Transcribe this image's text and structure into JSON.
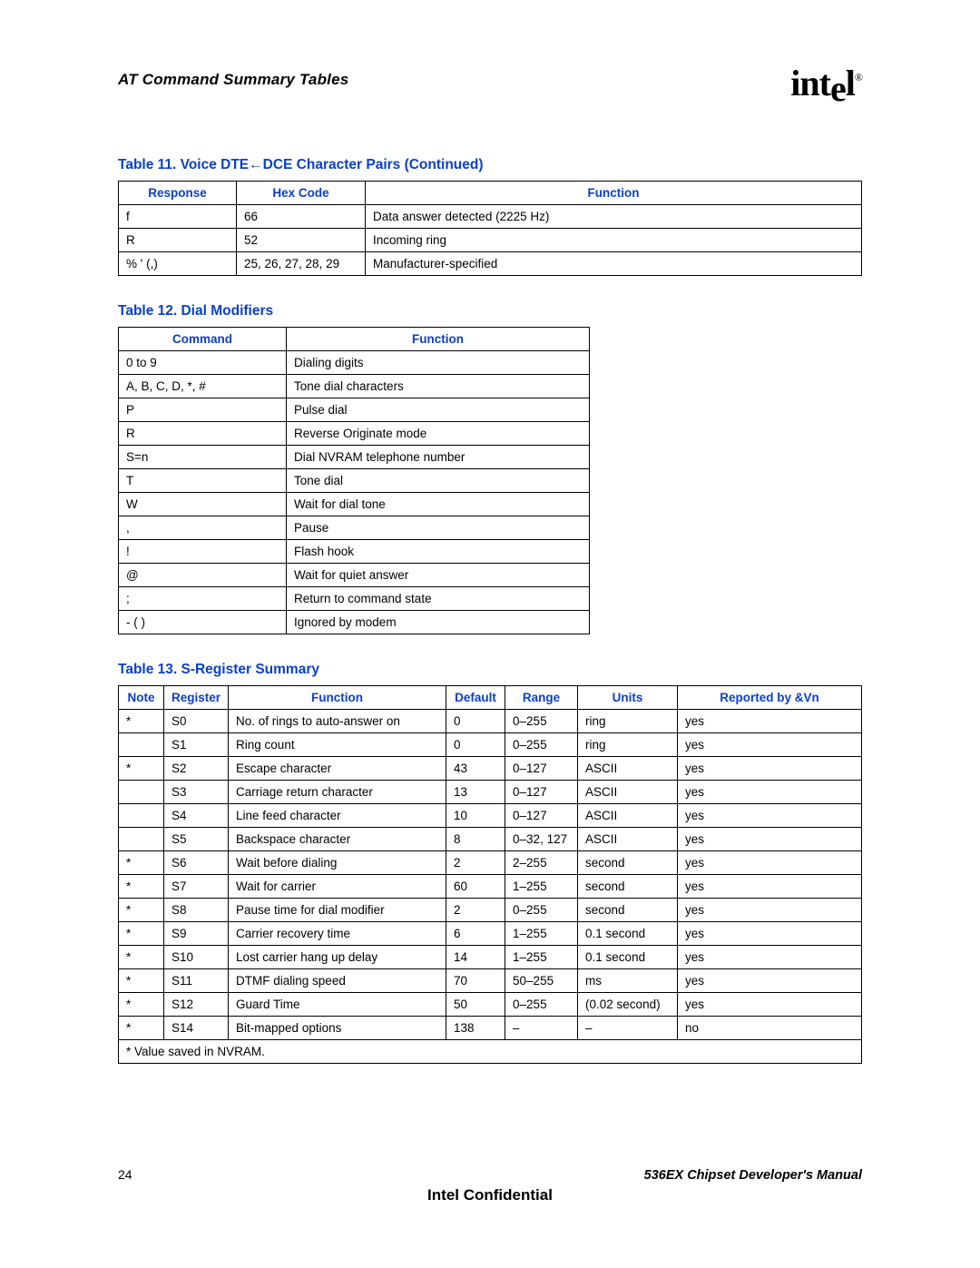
{
  "header": {
    "section_title": "AT Command Summary Tables",
    "logo_text": "intel",
    "logo_reg": "®"
  },
  "table11": {
    "caption": "Table 11.  Voice DTE←DCE Character Pairs (Continued)",
    "headers": {
      "response": "Response",
      "hex": "Hex Code",
      "function": "Function"
    },
    "rows": [
      {
        "response": "f",
        "hex": "66",
        "function": "Data answer detected (2225 Hz)"
      },
      {
        "response": "R",
        "hex": "52",
        "function": "Incoming ring"
      },
      {
        "response": "% ' (,)",
        "hex": "25, 26, 27, 28, 29",
        "function": "Manufacturer-specified"
      }
    ]
  },
  "table12": {
    "caption": "Table 12.  Dial Modifiers",
    "headers": {
      "command": "Command",
      "function": "Function"
    },
    "rows": [
      {
        "command": "0 to 9",
        "function": "Dialing digits"
      },
      {
        "command": "A, B, C, D, *, #",
        "function": "Tone dial characters"
      },
      {
        "command": "P",
        "function": "Pulse dial"
      },
      {
        "command": "R",
        "function": "Reverse Originate mode"
      },
      {
        "command": "S=n",
        "function": "Dial NVRAM telephone number"
      },
      {
        "command": "T",
        "function": "Tone dial"
      },
      {
        "command": "W",
        "function": "Wait for dial tone"
      },
      {
        "command": ",",
        "function": "Pause"
      },
      {
        "command": "!",
        "function": "Flash hook"
      },
      {
        "command": "@",
        "function": "Wait for quiet answer"
      },
      {
        "command": ";",
        "function": "Return to command state"
      },
      {
        "command": "- ( )",
        "function": "Ignored by modem"
      }
    ]
  },
  "table13": {
    "caption": "Table 13.  S-Register Summary",
    "headers": {
      "note": "Note",
      "register": "Register",
      "function": "Function",
      "default": "Default",
      "range": "Range",
      "units": "Units",
      "reported": "Reported by &Vn"
    },
    "rows": [
      {
        "note": "*",
        "register": "S0",
        "function": "No. of rings to auto-answer on",
        "default": "0",
        "range": "0–255",
        "units": "ring",
        "reported": "yes"
      },
      {
        "note": "",
        "register": "S1",
        "function": "Ring count",
        "default": "0",
        "range": "0–255",
        "units": "ring",
        "reported": "yes"
      },
      {
        "note": "*",
        "register": "S2",
        "function": "Escape character",
        "default": "43",
        "range": "0–127",
        "units": "ASCII",
        "reported": "yes"
      },
      {
        "note": "",
        "register": "S3",
        "function": "Carriage return character",
        "default": "13",
        "range": "0–127",
        "units": "ASCII",
        "reported": "yes"
      },
      {
        "note": "",
        "register": "S4",
        "function": "Line feed character",
        "default": "10",
        "range": "0–127",
        "units": "ASCII",
        "reported": "yes"
      },
      {
        "note": "",
        "register": "S5",
        "function": "Backspace character",
        "default": "8",
        "range": "0–32, 127",
        "units": "ASCII",
        "reported": "yes"
      },
      {
        "note": "*",
        "register": "S6",
        "function": "Wait before dialing",
        "default": "2",
        "range": "2–255",
        "units": "second",
        "reported": "yes"
      },
      {
        "note": "*",
        "register": "S7",
        "function": "Wait for carrier",
        "default": "60",
        "range": "1–255",
        "units": "second",
        "reported": "yes"
      },
      {
        "note": "*",
        "register": "S8",
        "function": "Pause time for dial modifier",
        "default": "2",
        "range": "0–255",
        "units": "second",
        "reported": "yes"
      },
      {
        "note": "*",
        "register": "S9",
        "function": "Carrier recovery time",
        "default": "6",
        "range": "1–255",
        "units": "0.1 second",
        "reported": "yes"
      },
      {
        "note": "*",
        "register": "S10",
        "function": "Lost carrier hang up delay",
        "default": "14",
        "range": "1–255",
        "units": "0.1 second",
        "reported": "yes"
      },
      {
        "note": "*",
        "register": "S11",
        "function": "DTMF dialing speed",
        "default": "70",
        "range": "50–255",
        "units": "ms",
        "reported": "yes"
      },
      {
        "note": "*",
        "register": "S12",
        "function": "Guard Time",
        "default": "50",
        "range": "0–255",
        "units": "(0.02 second)",
        "reported": "yes"
      },
      {
        "note": "*",
        "register": "S14",
        "function": "Bit-mapped options",
        "default": "138",
        "range": "–",
        "units": "–",
        "reported": "no"
      }
    ],
    "footnote": "* Value saved in NVRAM."
  },
  "footer": {
    "page_number": "24",
    "doc_title": "536EX Chipset Developer's Manual",
    "confidential": "Intel Confidential"
  }
}
